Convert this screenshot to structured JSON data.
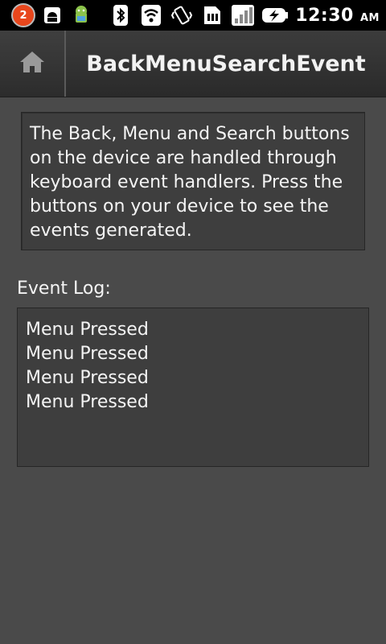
{
  "status_bar": {
    "notification_count": "2",
    "icons": [
      "notification-badge-icon",
      "android-icon",
      "android-app-icon",
      "bluetooth-icon",
      "wifi-icon",
      "vibrate-icon",
      "sim-icon",
      "signal-icon",
      "battery-icon"
    ],
    "time": "12:30",
    "ampm": "AM"
  },
  "titlebar": {
    "home_icon": "home-icon",
    "title": "BackMenuSearchEvent"
  },
  "description": "The Back, Menu and Search buttons on the device are handled through keyboard event handlers. Press the buttons on your device to see the events generated.",
  "event_log": {
    "label": "Event Log:",
    "entries": [
      "Menu Pressed",
      "Menu Pressed",
      "Menu Pressed",
      "Menu Pressed"
    ]
  }
}
